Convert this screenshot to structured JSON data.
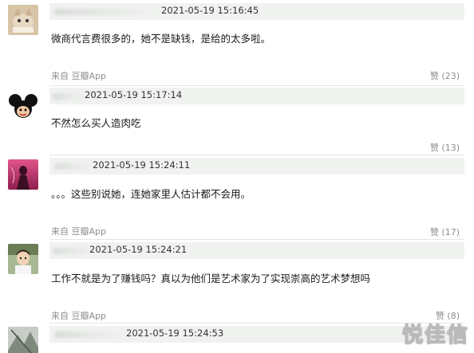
{
  "comments": [
    {
      "timestamp": "2021-05-19 15:16:45",
      "text": "微商代言费很多的，她不是缺钱，是给的太多啦。",
      "source": "来自 豆瓣App",
      "likes": "赞 (23)"
    },
    {
      "timestamp": "2021-05-19 15:17:14",
      "text": "不然怎么买人造肉吃",
      "source": "",
      "likes": "赞 (13)"
    },
    {
      "timestamp": "2021-05-19 15:24:11",
      "text": "。。。这些别说她，连她家里人估计都不会用。",
      "source": "来自 豆瓣App",
      "likes": "赞 (17)"
    },
    {
      "timestamp": "2021-05-19 15:24:21",
      "text": "工作不就是为了赚钱吗？真以为他们是艺术家为了实现崇高的艺术梦想吗",
      "source": "来自 豆瓣App",
      "likes": "赞 (8)"
    },
    {
      "timestamp": "2021-05-19 15:24:53",
      "text": "",
      "source": "",
      "likes": ""
    }
  ],
  "watermark": "悦佳信",
  "avatar_colors": [
    "#c9b08e",
    "#1a1a1a",
    "#c23a6a",
    "#6b7d55",
    "#9aa39a"
  ]
}
